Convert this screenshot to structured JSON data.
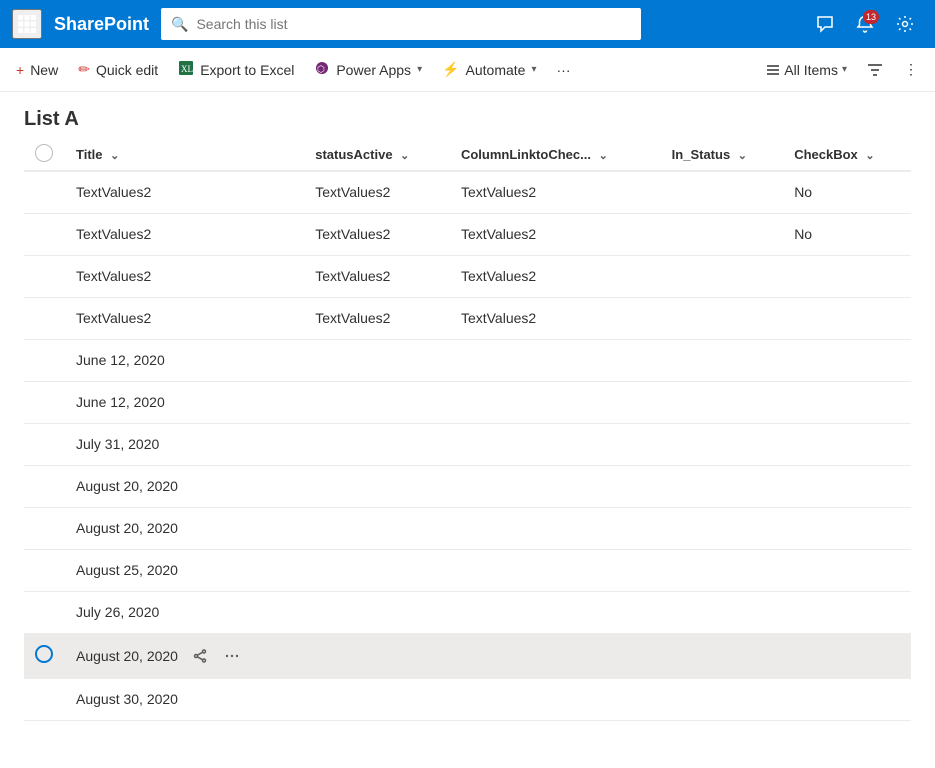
{
  "nav": {
    "waffle_icon": "⊞",
    "brand": "SharePoint",
    "search_placeholder": "Search this list",
    "icons": [
      {
        "name": "chat-icon",
        "symbol": "🗨",
        "badge": null
      },
      {
        "name": "notification-icon",
        "symbol": "🔔",
        "badge": "13"
      },
      {
        "name": "settings-icon",
        "symbol": "⚙"
      }
    ]
  },
  "commandbar": {
    "new_label": "New",
    "quick_edit_label": "Quick edit",
    "export_label": "Export to Excel",
    "power_apps_label": "Power Apps",
    "automate_label": "Automate",
    "more_label": "···",
    "view_label": "All Items",
    "new_icon": "+",
    "edit_icon": "✏",
    "export_icon": "↗",
    "power_icon": "⬡",
    "automate_icon": "⚡"
  },
  "page": {
    "title": "List A"
  },
  "table": {
    "columns": [
      {
        "id": "title",
        "label": "Title"
      },
      {
        "id": "statusActive",
        "label": "statusActive"
      },
      {
        "id": "columnLinktoChec",
        "label": "ColumnLinktoChec..."
      },
      {
        "id": "in_status",
        "label": "In_Status"
      },
      {
        "id": "checkbox",
        "label": "CheckBox"
      }
    ],
    "rows": [
      {
        "title": "TextValues2",
        "statusActive": "TextValues2",
        "columnLinktoChec": "TextValues2",
        "in_status": "",
        "checkbox": "No",
        "selected": false
      },
      {
        "title": "TextValues2",
        "statusActive": "TextValues2",
        "columnLinktoChec": "TextValues2",
        "in_status": "",
        "checkbox": "No",
        "selected": false
      },
      {
        "title": "TextValues2",
        "statusActive": "TextValues2",
        "columnLinktoChec": "TextValues2",
        "in_status": "",
        "checkbox": "",
        "selected": false
      },
      {
        "title": "TextValues2",
        "statusActive": "TextValues2",
        "columnLinktoChec": "TextValues2",
        "in_status": "",
        "checkbox": "",
        "selected": false
      },
      {
        "title": "June 12, 2020",
        "statusActive": "",
        "columnLinktoChec": "",
        "in_status": "",
        "checkbox": "",
        "selected": false
      },
      {
        "title": "June 12, 2020",
        "statusActive": "",
        "columnLinktoChec": "",
        "in_status": "",
        "checkbox": "",
        "selected": false
      },
      {
        "title": "July 31, 2020",
        "statusActive": "",
        "columnLinktoChec": "",
        "in_status": "",
        "checkbox": "",
        "selected": false
      },
      {
        "title": "August 20, 2020",
        "statusActive": "",
        "columnLinktoChec": "",
        "in_status": "",
        "checkbox": "",
        "selected": false
      },
      {
        "title": "August 20, 2020",
        "statusActive": "",
        "columnLinktoChec": "",
        "in_status": "",
        "checkbox": "",
        "selected": false
      },
      {
        "title": "August 25, 2020",
        "statusActive": "",
        "columnLinktoChec": "",
        "in_status": "",
        "checkbox": "",
        "selected": false
      },
      {
        "title": "July 26, 2020",
        "statusActive": "",
        "columnLinktoChec": "",
        "in_status": "",
        "checkbox": "",
        "selected": false
      },
      {
        "title": "August 20, 2020",
        "statusActive": "",
        "columnLinktoChec": "",
        "in_status": "",
        "checkbox": "",
        "selected": true
      },
      {
        "title": "August 30, 2020",
        "statusActive": "",
        "columnLinktoChec": "",
        "in_status": "",
        "checkbox": "",
        "selected": false
      }
    ]
  }
}
